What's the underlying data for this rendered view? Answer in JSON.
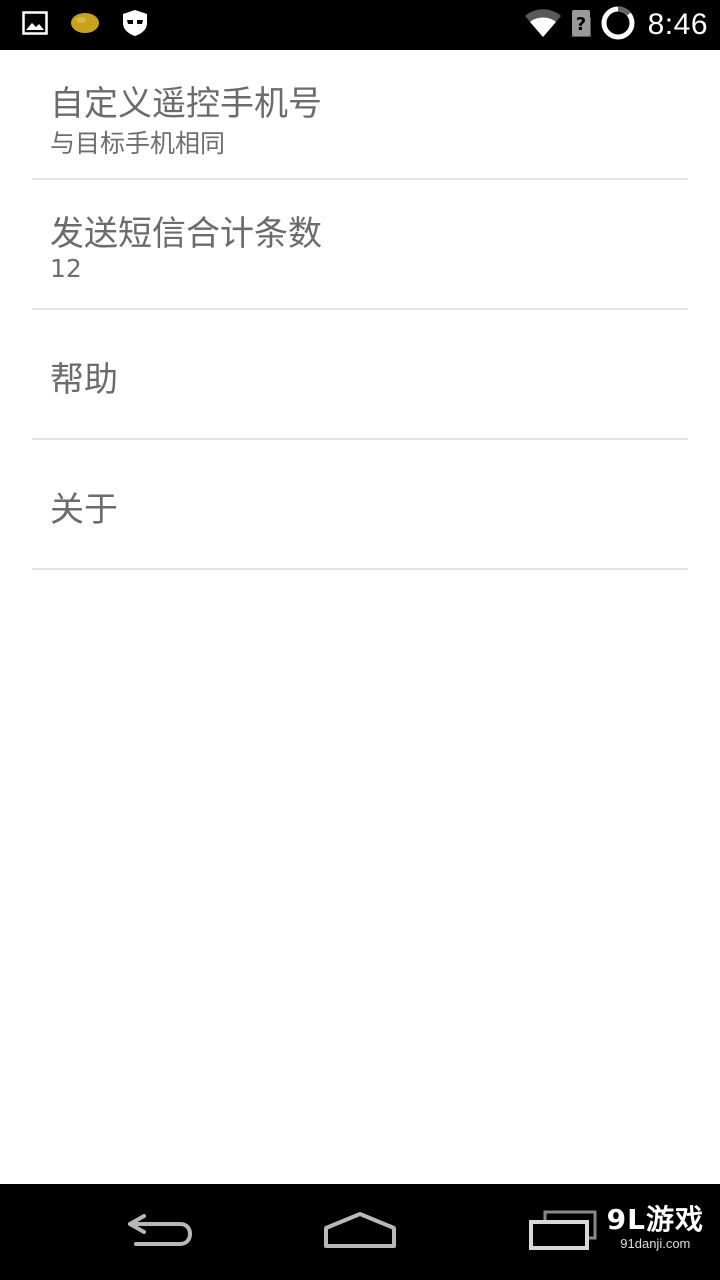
{
  "status_bar": {
    "time": "8:46",
    "icons": [
      "image-notification-icon",
      "lemon-notification-icon",
      "mask-notification-icon",
      "wifi-icon",
      "no-sim-icon",
      "battery-circle-icon"
    ]
  },
  "preferences": [
    {
      "title": "自定义遥控手机号",
      "summary": "与目标手机相同"
    },
    {
      "title": "发送短信合计条数",
      "summary": "12"
    },
    {
      "title": "帮助",
      "summary": ""
    },
    {
      "title": "关于",
      "summary": ""
    }
  ],
  "nav_bar": {
    "buttons": [
      "back-icon",
      "home-icon",
      "recent-apps-icon"
    ],
    "watermark_main": "9L游戏",
    "watermark_sub": "91danji.com"
  },
  "colors": {
    "status_bar_bg": "#000000",
    "nav_bar_bg": "#000000",
    "text_primary": "#6b6b6b",
    "divider": "#e2e2e2"
  }
}
